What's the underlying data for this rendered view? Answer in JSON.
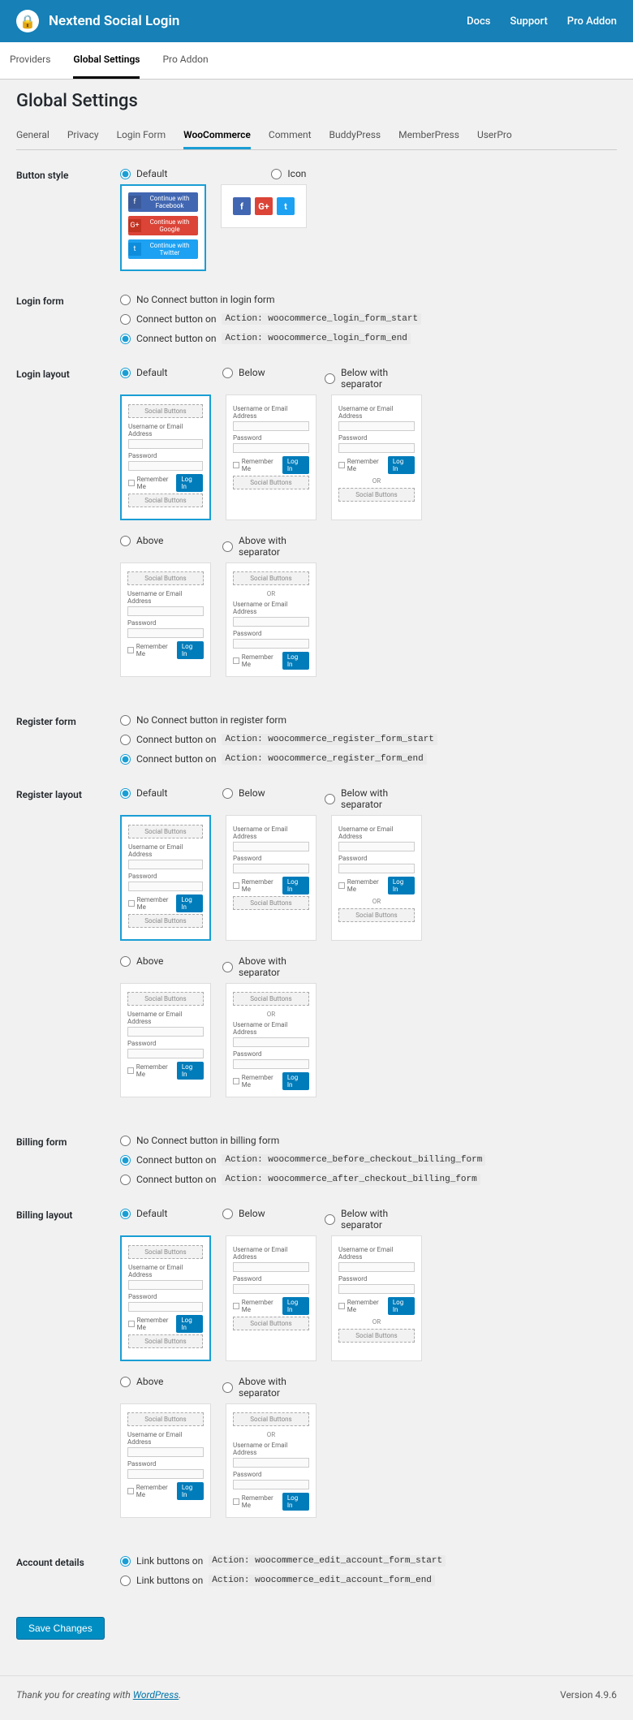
{
  "topbar": {
    "title": "Nextend Social Login",
    "links": [
      "Docs",
      "Support",
      "Pro Addon"
    ]
  },
  "mainTabs": [
    "Providers",
    "Global Settings",
    "Pro Addon"
  ],
  "mainActive": 1,
  "pageTitle": "Global Settings",
  "subTabs": [
    "General",
    "Privacy",
    "Login Form",
    "WooCommerce",
    "Comment",
    "BuddyPress",
    "MemberPress",
    "UserPro"
  ],
  "subActive": 3,
  "buttonStyle": {
    "label": "Button style",
    "options": [
      "Default",
      "Icon"
    ],
    "selected": 0,
    "socialButtons": [
      {
        "cls": "fb",
        "icon": "f",
        "label": "Continue with Facebook"
      },
      {
        "cls": "gg",
        "icon": "G+",
        "label": "Continue with Google"
      },
      {
        "cls": "tw",
        "icon": "t",
        "label": "Continue with Twitter"
      }
    ]
  },
  "loginForm": {
    "label": "Login form",
    "options": [
      {
        "text": "No Connect button in login form"
      },
      {
        "text": "Connect button on ",
        "code": "Action: woocommerce_login_form_start"
      },
      {
        "text": "Connect button on ",
        "code": "Action: woocommerce_login_form_end"
      }
    ],
    "selected": 2
  },
  "loginLayout": {
    "label": "Login layout",
    "row1": [
      "Default",
      "Below",
      "Below with separator"
    ],
    "row2": [
      "Above",
      "Above with separator"
    ],
    "selected": 0
  },
  "registerForm": {
    "label": "Register form",
    "options": [
      {
        "text": "No Connect button in register form"
      },
      {
        "text": "Connect button on ",
        "code": "Action: woocommerce_register_form_start"
      },
      {
        "text": "Connect button on ",
        "code": "Action: woocommerce_register_form_end"
      }
    ],
    "selected": 2
  },
  "registerLayout": {
    "label": "Register layout",
    "row1": [
      "Default",
      "Below",
      "Below with separator"
    ],
    "row2": [
      "Above",
      "Above with separator"
    ],
    "selected": 0
  },
  "billingForm": {
    "label": "Billing form",
    "options": [
      {
        "text": "No Connect button in billing form"
      },
      {
        "text": "Connect button on ",
        "code": "Action: woocommerce_before_checkout_billing_form"
      },
      {
        "text": "Connect button on ",
        "code": "Action: woocommerce_after_checkout_billing_form"
      }
    ],
    "selected": 1
  },
  "billingLayout": {
    "label": "Billing layout",
    "row1": [
      "Default",
      "Below",
      "Below with separator"
    ],
    "row2": [
      "Above",
      "Above with separator"
    ],
    "selected": 0
  },
  "accountDetails": {
    "label": "Account details",
    "options": [
      {
        "text": "Link buttons on ",
        "code": "Action: woocommerce_edit_account_form_start"
      },
      {
        "text": "Link buttons on ",
        "code": "Action: woocommerce_edit_account_form_end"
      }
    ],
    "selected": 0
  },
  "preview": {
    "social": "Social Buttons",
    "userLabel": "Username or Email Address",
    "passLabel": "Password",
    "remember": "Remember Me",
    "login": "Log In",
    "or": "OR"
  },
  "saveButton": "Save Changes",
  "footer": {
    "text1": "Thank you for creating with ",
    "link": "WordPress",
    "text2": ".",
    "version": "Version 4.9.6"
  }
}
